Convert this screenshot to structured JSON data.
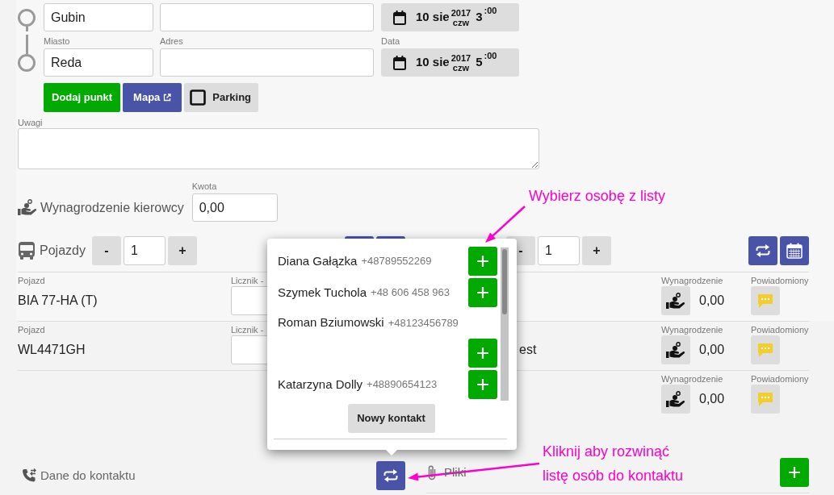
{
  "route": {
    "points": [
      {
        "city": "Gubin",
        "date": {
          "day": "10 sie",
          "year": "2017",
          "weekday": "czw",
          "hour": "3",
          "minutes": ":00"
        }
      },
      {
        "city_label": "Miasto",
        "city": "Reda",
        "address_label": "Adres",
        "date_label": "Data",
        "date": {
          "day": "10 sie",
          "year": "2017",
          "weekday": "czw",
          "hour": "5",
          "minutes": ":00"
        }
      }
    ],
    "buttons": [
      {
        "kind": "add",
        "label": "Dodaj punkt"
      },
      {
        "kind": "map",
        "label": "Mapa"
      },
      {
        "kind": "checkbox",
        "label": "Parking",
        "checked": false
      }
    ]
  },
  "notes": {
    "label": "Uwagi"
  },
  "driver_pay": {
    "label": "Wynagrodzenie kierowcy",
    "amount_label": "Kwota",
    "amount": "0,00"
  },
  "counters": [
    {
      "kind": "vehicles",
      "label": "Pojazdy",
      "minus": "-",
      "value": "1",
      "plus": "+",
      "buttons": [
        {
          "kind": "plain"
        },
        {
          "kind": "plain"
        }
      ]
    },
    {
      "minus": "-",
      "value": "1",
      "plus": "+",
      "buttons": [
        {
          "kind": "swap"
        },
        {
          "kind": "calendar"
        }
      ]
    }
  ],
  "vehicle_rows": [
    {
      "vehicle_label": "Pojazd",
      "vehicle": "BIA 77-HA (T)",
      "counter_label": "Licznik -",
      "pay_label": "Wynagrodzenie",
      "pay": "0,00",
      "notified_label": "Powiadomiony"
    },
    {
      "vehicle_label": "Pojazd",
      "vehicle": "WL4471GH",
      "counter_label": "Licznik -",
      "driver": "est",
      "pay_label": "Wynagrodzenie",
      "pay": "0,00",
      "notified_label": "Powiadomiony"
    },
    {
      "pay_label": "Wynagrodzenie",
      "pay": "0,00",
      "notified_label": "Powiadomiony"
    }
  ],
  "contacts_bar": {
    "label": "Dane do kontaktu",
    "files_label": "Pliki"
  },
  "contact_popup": {
    "contacts": [
      {
        "name": "Diana Gałązka",
        "phone": "+48789552269"
      },
      {
        "name": "Szymek Tuchola",
        "phone": "+48 606 458 963"
      },
      {
        "name": "Roman Bziumowski",
        "phone": "+48123456789"
      },
      {
        "name": "Katarzyna Dolly",
        "phone": "+48890654123"
      }
    ],
    "new_contact": "Nowy kontakt"
  },
  "annotations": [
    {
      "lines": [
        "Wybierz osobę z listy"
      ]
    },
    {
      "lines": [
        "Kliknij aby rozwinąć",
        "listę osób do kontaktu"
      ]
    }
  ]
}
